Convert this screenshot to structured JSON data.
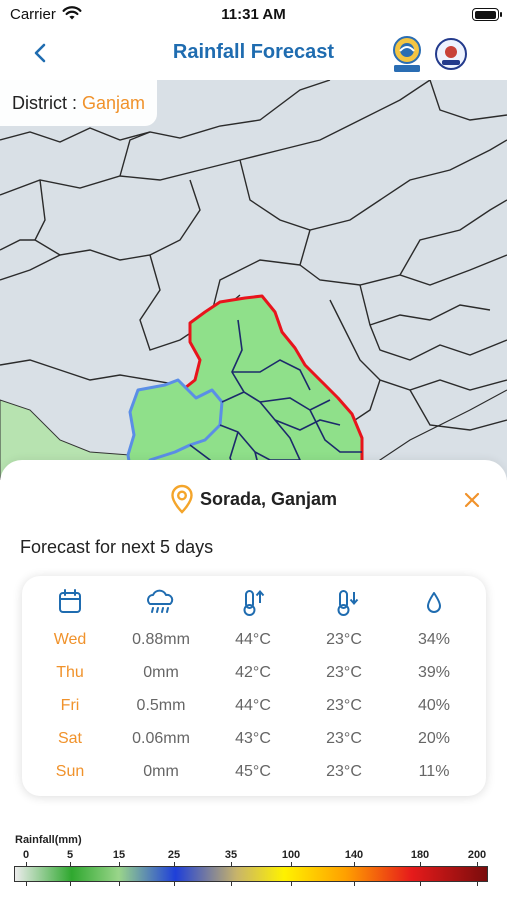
{
  "status": {
    "carrier": "Carrier",
    "time": "11:31 AM",
    "battery_level": 1.0
  },
  "nav": {
    "title": "Rainfall Forecast",
    "back_icon": "chevron-left-icon",
    "logos": [
      "OSDMA",
      "Odisha state seal"
    ]
  },
  "district": {
    "label": "District",
    "separator": " : ",
    "value": "Ganjam"
  },
  "location": {
    "name": "Sorada, Ganjam",
    "icon": "location-pin-icon"
  },
  "forecast": {
    "title": "Forecast for next 5 days",
    "header_icons": [
      "calendar-icon",
      "rain-cloud-icon",
      "thermometer-high-icon",
      "thermometer-low-icon",
      "humidity-drop-icon"
    ],
    "rows": [
      {
        "day": "Wed",
        "rain": "0.88mm",
        "max": "44°C",
        "min": "23°C",
        "humidity": "34%"
      },
      {
        "day": "Thu",
        "rain": "0mm",
        "max": "42°C",
        "min": "23°C",
        "humidity": "39%"
      },
      {
        "day": "Fri",
        "rain": "0.5mm",
        "max": "44°C",
        "min": "23°C",
        "humidity": "40%"
      },
      {
        "day": "Sat",
        "rain": "0.06mm",
        "max": "43°C",
        "min": "23°C",
        "humidity": "20%"
      },
      {
        "day": "Sun",
        "rain": "0mm",
        "max": "45°C",
        "min": "23°C",
        "humidity": "11%"
      }
    ]
  },
  "legend": {
    "title": "Rainfall(mm)",
    "ticks": [
      "0",
      "5",
      "15",
      "25",
      "35",
      "100",
      "140",
      "180",
      "200"
    ]
  },
  "colors": {
    "accent": "#1f6cb0",
    "orange": "#f0922b",
    "district_border": "#e8141c",
    "block_border": "#3b78e7",
    "forecast_fill": "#8fe08a"
  }
}
